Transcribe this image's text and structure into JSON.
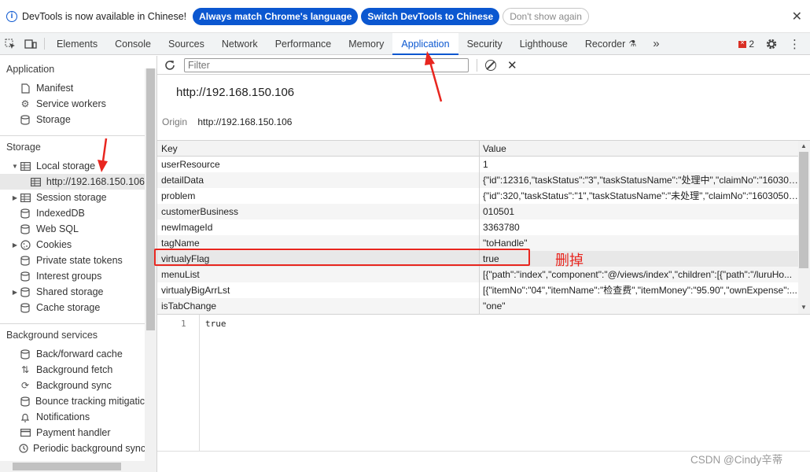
{
  "infobar": {
    "message": "DevTools is now available in Chinese!",
    "btn_match": "Always match Chrome's language",
    "btn_switch": "Switch DevTools to Chinese",
    "btn_dismiss": "Don't show again"
  },
  "tabs": [
    "Elements",
    "Console",
    "Sources",
    "Network",
    "Performance",
    "Memory",
    "Application",
    "Security",
    "Lighthouse",
    "Recorder"
  ],
  "active_tab": "Application",
  "error_count": "2",
  "sidebar": {
    "application_header": "Application",
    "app_items": [
      "Manifest",
      "Service workers",
      "Storage"
    ],
    "storage_header": "Storage",
    "local_storage": "Local storage",
    "local_origin": "http://192.168.150.106",
    "storage_items": [
      "Session storage",
      "IndexedDB",
      "Web SQL",
      "Cookies",
      "Private state tokens",
      "Interest groups",
      "Shared storage",
      "Cache storage"
    ],
    "bg_header": "Background services",
    "bg_items": [
      "Back/forward cache",
      "Background fetch",
      "Background sync",
      "Bounce tracking mitigatic",
      "Notifications",
      "Payment handler",
      "Periodic background sync"
    ]
  },
  "toolbar": {
    "filter_placeholder": "Filter"
  },
  "origin": {
    "title": "http://192.168.150.106",
    "label": "Origin",
    "value": "http://192.168.150.106"
  },
  "table": {
    "headers": {
      "key": "Key",
      "value": "Value"
    },
    "rows": [
      {
        "key": "userResource",
        "value": "1"
      },
      {
        "key": "detailData",
        "value": "{\"id\":12316,\"taskStatus\":\"3\",\"taskStatusName\":\"处理中\",\"claimNo\":\"160305..."
      },
      {
        "key": "problem",
        "value": "{\"id\":320,\"taskStatus\":\"1\",\"taskStatusName\":\"未处理\",\"claimNo\":\"16030502..."
      },
      {
        "key": "customerBusiness",
        "value": "010501"
      },
      {
        "key": "newImageId",
        "value": "3363780"
      },
      {
        "key": "tagName",
        "value": "\"toHandle\""
      },
      {
        "key": "virtualyFlag",
        "value": "true"
      },
      {
        "key": "menuList",
        "value": "[{\"path\":\"index\",\"component\":\"@/views/index\",\"children\":[{\"path\":\"/luruHo..."
      },
      {
        "key": "virtualyBigArrLst",
        "value": "[{\"itemNo\":\"04\",\"itemName\":\"检查费\",\"itemMoney\":\"95.90\",\"ownExpense\":..."
      },
      {
        "key": "isTabChange",
        "value": "\"one\""
      }
    ]
  },
  "preview": {
    "line": "1",
    "code": "true"
  },
  "annotation": "删掉",
  "watermark": "CSDN @Cindy辛蒂",
  "colors": {
    "accent": "#0b57d0",
    "annotation_red": "#e8261f"
  }
}
